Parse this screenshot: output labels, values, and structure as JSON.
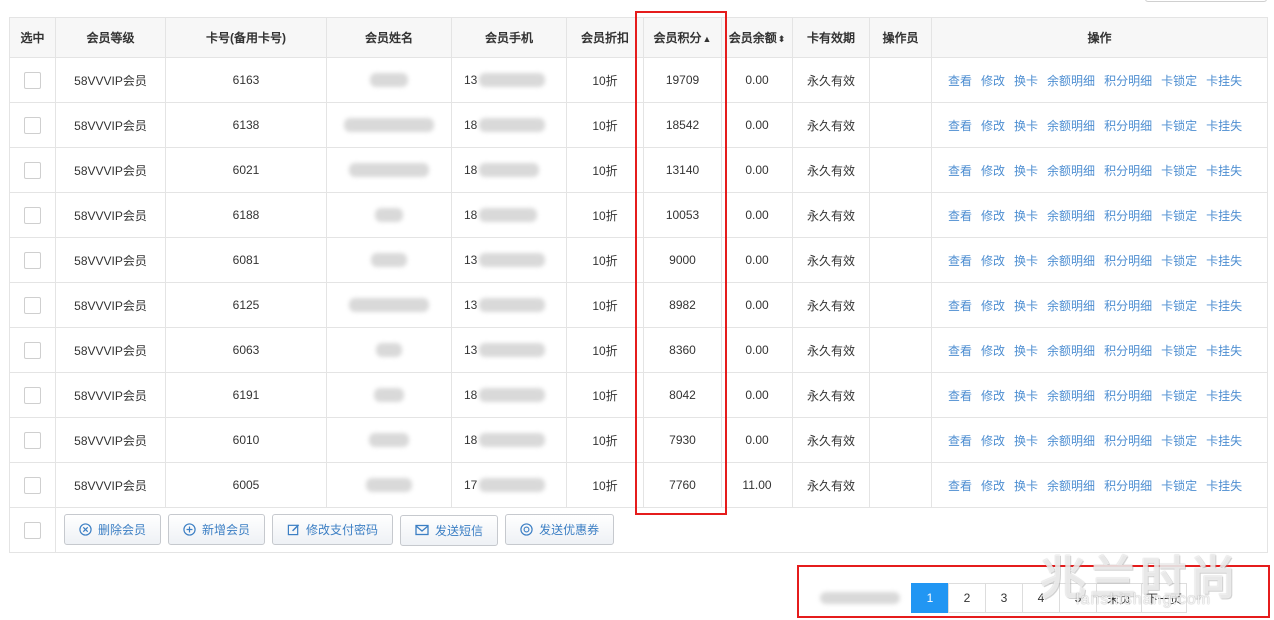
{
  "columns": {
    "select": "选中",
    "level": "会员等级",
    "card_no": "卡号(备用卡号)",
    "name": "会员姓名",
    "phone": "会员手机",
    "discount": "会员折扣",
    "points": "会员积分",
    "points_sort": "▲",
    "balance": "会员余额",
    "balance_sort": "⬍",
    "validity": "卡有效期",
    "operator": "操作员",
    "actions": "操作"
  },
  "row_actions": [
    "查看",
    "修改",
    "换卡",
    "余额明细",
    "积分明细",
    "卡锁定",
    "卡挂失"
  ],
  "rows": [
    {
      "level": "58VVVIP会员",
      "card": "6163",
      "phone_prefix": "13",
      "discount": "10折",
      "points": "19709",
      "balance": "0.00",
      "validity": "永久有效",
      "operator": ""
    },
    {
      "level": "58VVVIP会员",
      "card": "6138",
      "phone_prefix": "18",
      "discount": "10折",
      "points": "18542",
      "balance": "0.00",
      "validity": "永久有效",
      "operator": ""
    },
    {
      "level": "58VVVIP会员",
      "card": "6021",
      "phone_prefix": "18",
      "discount": "10折",
      "points": "13140",
      "balance": "0.00",
      "validity": "永久有效",
      "operator": ""
    },
    {
      "level": "58VVVIP会员",
      "card": "6188",
      "phone_prefix": "18",
      "discount": "10折",
      "points": "10053",
      "balance": "0.00",
      "validity": "永久有效",
      "operator": ""
    },
    {
      "level": "58VVVIP会员",
      "card": "6081",
      "phone_prefix": "13",
      "discount": "10折",
      "points": "9000",
      "balance": "0.00",
      "validity": "永久有效",
      "operator": ""
    },
    {
      "level": "58VVVIP会员",
      "card": "6125",
      "phone_prefix": "13",
      "discount": "10折",
      "points": "8982",
      "balance": "0.00",
      "validity": "永久有效",
      "operator": ""
    },
    {
      "level": "58VVVIP会员",
      "card": "6063",
      "phone_prefix": "13",
      "discount": "10折",
      "points": "8360",
      "balance": "0.00",
      "validity": "永久有效",
      "operator": ""
    },
    {
      "level": "58VVVIP会员",
      "card": "6191",
      "phone_prefix": "18",
      "discount": "10折",
      "points": "8042",
      "balance": "0.00",
      "validity": "永久有效",
      "operator": ""
    },
    {
      "level": "58VVVIP会员",
      "card": "6010",
      "phone_prefix": "18",
      "discount": "10折",
      "points": "7930",
      "balance": "0.00",
      "validity": "永久有效",
      "operator": ""
    },
    {
      "level": "58VVVIP会员",
      "card": "6005",
      "phone_prefix": "17",
      "discount": "10折",
      "points": "7760",
      "balance": "11.00",
      "validity": "永久有效",
      "operator": ""
    }
  ],
  "footer_buttons": [
    {
      "label": "删除会员",
      "icon": "delete-circle-icon"
    },
    {
      "label": "新增会员",
      "icon": "plus-circle-icon"
    },
    {
      "label": "修改支付密码",
      "icon": "edit-icon"
    },
    {
      "label": "发送短信",
      "icon": "mail-icon"
    },
    {
      "label": "发送优惠券",
      "icon": "coupon-icon"
    }
  ],
  "pagination": {
    "pages": [
      "1",
      "2",
      "3",
      "4",
      "5"
    ],
    "current": "1",
    "last": "末页",
    "next": "下一页"
  },
  "watermark": {
    "main": "兆兰时尚",
    "sub": "lanshishang.com"
  },
  "colors": {
    "link": "#4d8ed1",
    "highlight": "#e51c1c",
    "active_page": "#2196f3"
  }
}
